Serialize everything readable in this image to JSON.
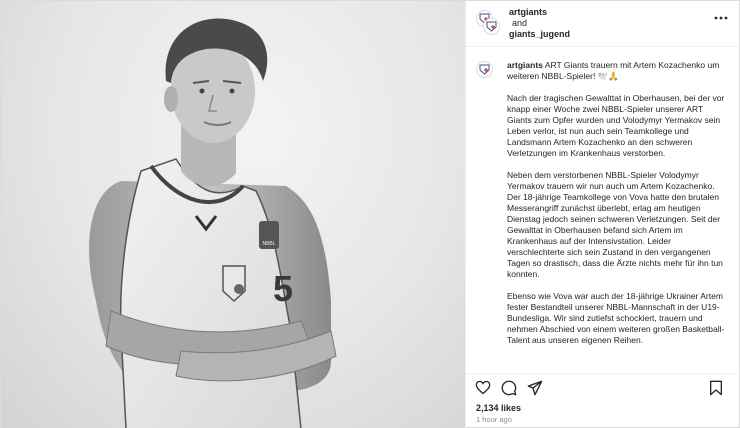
{
  "header": {
    "account_1": "artgiants",
    "conjunction": "and",
    "account_2": "giants_jugend",
    "more_icon": "more-horizontal-icon"
  },
  "caption": {
    "username": "artgiants",
    "intro": "ART Giants trauern mit Artem Kozachenko um weiteren NBBL-Spieler! 🕊️🙏",
    "paragraphs": [
      "Nach der tragischen Gewalttat in Oberhausen, bei der vor knapp einer Woche zwei NBBL-Spieler unserer ART Giants zum Opfer wurden und Volodymyr Yermakov sein Leben verlor, ist nun auch sein Teamkollege und Landsmann Artem Kozachenko an den schweren Verletzungen im Krankenhaus verstorben.",
      "Neben dem verstorbenen NBBL-Spieler Volodymyr Yermakov trauern wir nun auch um Artem Kozachenko. Der 18-jährige Teamkollege von Vova hatte den brutalen Messerangriff zunächst überlebt, erlag am heutigen Dienstag jedoch seinen schweren Verletzungen. Seit der Gewalttat in Oberhausen befand sich Artem im Krankenhaus auf der Intensivstation. Leider verschlechterte sich sein Zustand in den vergangenen Tagen so drastisch, dass die Ärzte nichts mehr für ihn tun konnten.",
      "Ebenso wie Vova war auch der 18-jährige Ukrainer Artem fester Bestandteil unserer NBBL-Mannschaft in der U19-Bundesliga. Wir sind zutiefst schockiert, trauern und nehmen Abschied von einem weiteren großen Basketball-Talent aus unseren eigenen Reihen."
    ]
  },
  "actions": {
    "like_icon": "heart-icon",
    "comment_icon": "comment-icon",
    "share_icon": "share-icon",
    "save_icon": "bookmark-icon"
  },
  "stats": {
    "likes": "2,134 likes",
    "time": "1 hour ago"
  },
  "photo": {
    "jersey_number": "5",
    "chest_logo": "ART Giants",
    "badge_text": "NBBL"
  }
}
